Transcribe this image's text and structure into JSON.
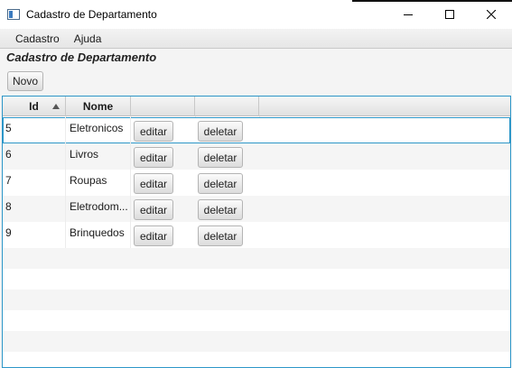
{
  "window": {
    "title": "Cadastro de Departamento",
    "controls": [
      "minimize-icon",
      "maximize-icon",
      "close-icon"
    ]
  },
  "menubar": {
    "items": [
      {
        "label": "Cadastro"
      },
      {
        "label": "Ajuda"
      }
    ]
  },
  "page": {
    "heading": "Cadastro de Departamento",
    "novo_label": "Novo"
  },
  "table": {
    "columns": [
      {
        "label": "Id",
        "sort": "ascending"
      },
      {
        "label": "Nome"
      },
      {
        "label": ""
      },
      {
        "label": ""
      },
      {
        "label": ""
      }
    ],
    "rows": [
      {
        "id": "5",
        "nome": "Eletronicos",
        "editar": "editar",
        "deletar": "deletar",
        "selected": true
      },
      {
        "id": "6",
        "nome": "Livros",
        "editar": "editar",
        "deletar": "deletar"
      },
      {
        "id": "7",
        "nome": "Roupas",
        "editar": "editar",
        "deletar": "deletar"
      },
      {
        "id": "8",
        "nome": "Eletrodom...",
        "editar": "editar",
        "deletar": "deletar"
      },
      {
        "id": "9",
        "nome": "Brinquedos",
        "editar": "editar",
        "deletar": "deletar"
      }
    ]
  },
  "colors": {
    "selection_border": "#2c96c8",
    "row_alt": "#f5f5f5"
  }
}
